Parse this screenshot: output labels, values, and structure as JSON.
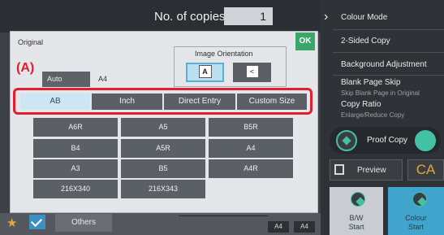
{
  "top": {
    "copies_label": "No. of copies",
    "copies_value": "1"
  },
  "right_menu": {
    "items": [
      "Colour Mode",
      "2-Sided Copy",
      "Background Adjustment",
      "Blank Page Skip",
      "Copy Ratio"
    ],
    "subs": {
      "blank": "Skip Blank Page in Original",
      "ratio": "Enlarge/Reduce Copy"
    },
    "proof": "Proof Copy",
    "preview": "Preview",
    "ca": "CA",
    "bw_start": [
      "B/W",
      "Start"
    ],
    "colour_start": [
      "Colour",
      "Start"
    ]
  },
  "bottom": {
    "others": "Others",
    "a4_left": "A4",
    "a4_right": "A4"
  },
  "dialog": {
    "title": "Original",
    "ok": "OK",
    "orientation_title": "Image Orientation",
    "orient_glyph_a": "A",
    "orient_glyph_b": "<",
    "auto": "Auto",
    "size_label": "A4",
    "callout": "(A)",
    "tabs": [
      "AB",
      "Inch",
      "Direct Entry",
      "Custom Size"
    ],
    "sizes": [
      "A6R",
      "A5",
      "B5R",
      "B4",
      "A5R",
      "A4",
      "A3",
      "B5",
      "A4R",
      "216X340",
      "216X343"
    ]
  },
  "colors": {
    "accent": "#43c1a4",
    "highlight": "#e0202e",
    "selected_tab": "#cde6f3"
  }
}
